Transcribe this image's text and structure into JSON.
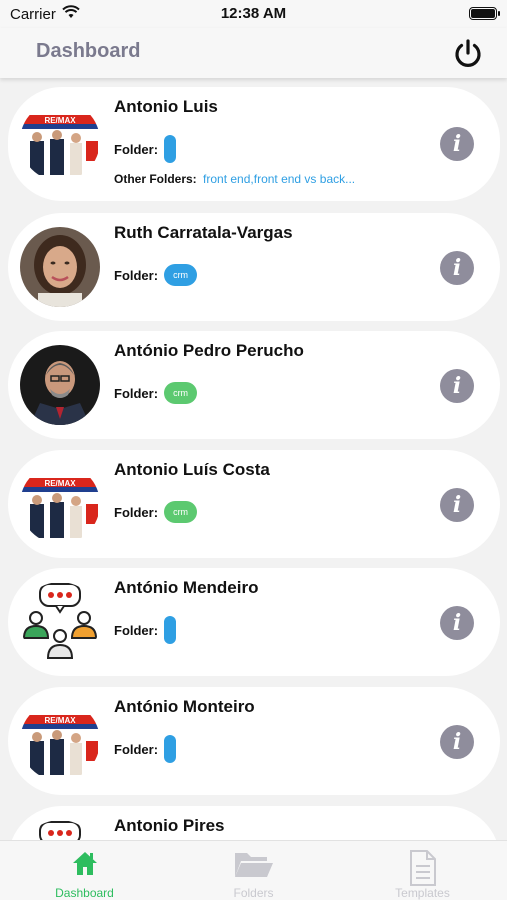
{
  "status_bar": {
    "carrier": "Carrier",
    "time": "12:38 AM"
  },
  "header": {
    "title": "Dashboard"
  },
  "contacts": [
    {
      "name": "Antonio Luis",
      "avatar": "remax-photo",
      "folder": null,
      "other_folders_label": "Other Folders:",
      "other_folders": "front end,front end vs back..."
    },
    {
      "name": "Ruth Carratala-Vargas",
      "avatar": "portrait-woman",
      "folder": "crm",
      "folder_color": "#2f9fe3"
    },
    {
      "name": "António Pedro Perucho",
      "avatar": "portrait-man",
      "folder": "crm",
      "folder_color": "#5cc970"
    },
    {
      "name": "Antonio Luís Costa",
      "avatar": "remax-photo",
      "folder": "crm",
      "folder_color": "#5cc970"
    },
    {
      "name": "António Mendeiro",
      "avatar": "group-chat-icon",
      "folder": null
    },
    {
      "name": "António Monteiro",
      "avatar": "remax-photo",
      "folder": null
    },
    {
      "name": "Antonio Pires",
      "avatar": "group-chat-icon",
      "folder": null
    }
  ],
  "labels": {
    "folder": "Folder:"
  },
  "tabs": [
    {
      "label": "Dashboard",
      "icon": "home-icon",
      "active": true
    },
    {
      "label": "Folders",
      "icon": "folder-open-icon",
      "active": false
    },
    {
      "label": "Templates",
      "icon": "document-icon",
      "active": false
    }
  ],
  "colors": {
    "accent_green": "#2ebd5f",
    "pill_blue": "#2f9fe3",
    "pill_green": "#5cc970",
    "info_gray": "#8f8d9c",
    "title_gray": "#7b7a8e"
  }
}
